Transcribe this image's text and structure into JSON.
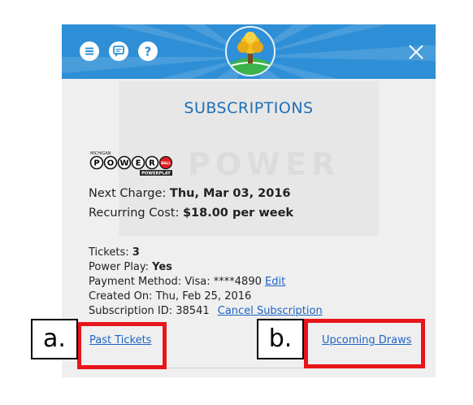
{
  "header": {
    "menu_icon": "hamburger-menu-icon",
    "chat_icon": "chat-icon",
    "help_icon": "help-icon",
    "logo": "michigan-lottery-tree-logo",
    "close_icon": "close-icon",
    "color": "#2e8fd6"
  },
  "page": {
    "title": "SUBSCRIPTIONS"
  },
  "subscription": {
    "game_logo": "powerball-powerplay-logo",
    "logo_text": {
      "state": "MICHIGAN",
      "letters": [
        "P",
        "O",
        "W",
        "E",
        "R"
      ],
      "ball": "BALL",
      "powerplay": "POWERPLAY"
    },
    "next_charge_label": "Next Charge:",
    "next_charge_value": "Thu, Mar 03, 2016",
    "recurring_cost_label": "Recurring Cost:",
    "recurring_cost_value": "$18.00 per week",
    "tickets_label": "Tickets:",
    "tickets_value": "3",
    "power_play_label": "Power Play:",
    "power_play_value": "Yes",
    "payment_method_label": "Payment Method: Visa: ****4890",
    "edit_link": "Edit",
    "created_on_label": "Created On: Thu, Feb 25, 2016",
    "subscription_id_label": "Subscription ID: 38541",
    "cancel_link": "Cancel Subscription"
  },
  "footer": {
    "past_tickets_link": "Past Tickets",
    "upcoming_draws_link": "Upcoming Draws"
  },
  "annotations": {
    "label_a": "a.",
    "label_b": "b.",
    "highlight_color": "#e8151b"
  }
}
